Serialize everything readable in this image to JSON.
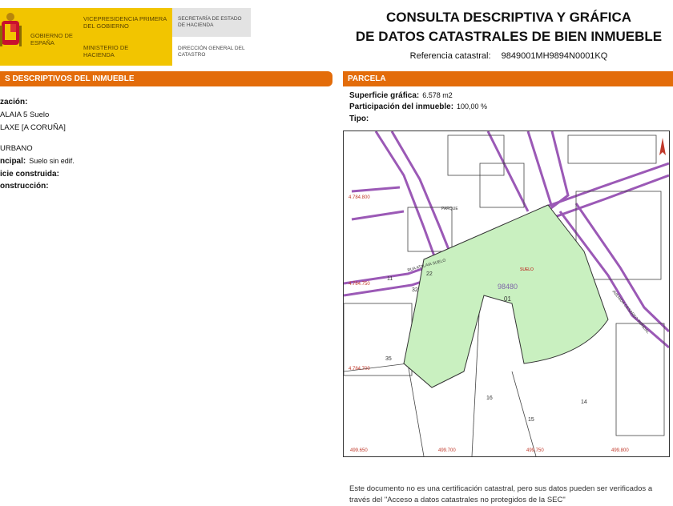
{
  "header": {
    "gov_espana": "GOBIERNO DE ESPAÑA",
    "vicepresidencia": "VICEPRESIDENCIA PRIMERA DEL GOBIERNO",
    "ministerio": "MINISTERIO DE HACIENDA",
    "secretaria": "SECRETARÍA DE ESTADO DE HACIENDA",
    "direccion": "DIRECCIÓN GENERAL DEL CATASTRO",
    "title_line1": "CONSULTA DESCRIPTIVA Y GRÁFICA",
    "title_line2": "DE DATOS CATASTRALES DE BIEN INMUEBLE",
    "ref_label": "Referencia catastral:",
    "ref_value": "9849001MH9894N0001KQ"
  },
  "left_panel": {
    "title": "S DESCRIPTIVOS DEL INMUEBLE",
    "localizacion_label": "zación:",
    "address_line1": "ALAIA 5 Suelo",
    "address_line2": "LAXE [A CORUÑA]",
    "clase": "URBANO",
    "uso_label": "ncipal:",
    "uso_value": "Suelo sin edif.",
    "superficie_label": "icie construida:",
    "construccion_label": "onstrucción:"
  },
  "parcela": {
    "title": "PARCELA",
    "superficie_label": "Superficie gráfica:",
    "superficie_value": "6.578 m2",
    "participacion_label": "Participación del inmueble:",
    "participacion_value": "100,00 %",
    "tipo_label": "Tipo:"
  },
  "map": {
    "parcel_fill": "#c9f0c0",
    "road_color": "#9b59b6",
    "parcel_id": "98480",
    "subparcel": "01",
    "suelo_label": "SUELO",
    "street_1": "RUA ATALAIA SUELO",
    "street_2": "AVENIDA CESAREO PONDAL",
    "coord_y1": "4.784.800",
    "coord_y2": "4.784.750",
    "coord_y3": "4.784.700",
    "coord_x1": "499.650",
    "coord_x2": "499.700",
    "coord_x3": "499.750",
    "coord_x4": "499.800",
    "parcel_n1": "11",
    "parcel_n2": "32",
    "parcel_n3": "22",
    "parcel_n4": "35",
    "parcel_n5": "16",
    "parcel_n6": "15",
    "parcel_n7": "14",
    "small_label": "PARQUE"
  },
  "footer": {
    "line1": "Este documento no es una certificación catastral, pero sus datos pueden ser verificados a",
    "line2": "través del \"Acceso a datos catastrales no protegidos de la SEC\""
  }
}
